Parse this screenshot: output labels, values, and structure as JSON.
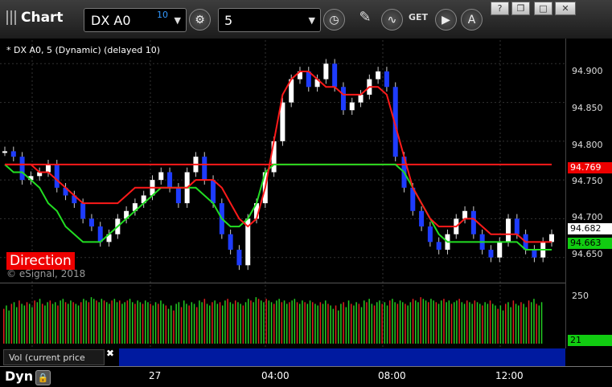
{
  "titlebar": {
    "app_title": "Chart",
    "symbol": "DX A0",
    "symbol_badge": "10",
    "interval": "5",
    "icons": [
      "settings-gear-icon",
      "clock-icon",
      "pencil-icon",
      "study-icon",
      "get-icon",
      "play-icon",
      "alert-icon"
    ],
    "window_buttons": [
      "help-button",
      "restore-button",
      "maximize-button",
      "close-button"
    ]
  },
  "chart": {
    "label": "* DX A0, 5 (Dynamic) (delayed 10)",
    "direction_label": "Direction",
    "copyright": "© eSignal, 2018",
    "y_ticks": [
      "94.900",
      "94.850",
      "94.800",
      "94.750",
      "94.700",
      "94.650"
    ],
    "red_tag": "94.769",
    "white_tag": "94.682",
    "green_tag": "94.663",
    "vol_label": "Vol (current price bar)",
    "vol_tick": "250",
    "vol_tag": "21",
    "x_ticks": [
      "27",
      "04:00",
      "08:00",
      "12:00"
    ],
    "dyn_label": "Dyn",
    "colors": {
      "red": "#ff1a1a",
      "green": "#22dd22",
      "blue": "#1e3cff",
      "white": "#ffffff"
    }
  },
  "chart_data": {
    "type": "line",
    "ylim": [
      94.63,
      94.92
    ],
    "series": [
      {
        "values": [
          94.787,
          94.78,
          94.75,
          94.755,
          94.76,
          94.77,
          94.74,
          94.73,
          94.72,
          94.7,
          94.69,
          94.67,
          94.68,
          94.7,
          94.71,
          94.72,
          94.73,
          94.75,
          94.76,
          94.74,
          94.72,
          94.76,
          94.78,
          94.75,
          94.72,
          94.68,
          94.66,
          94.64,
          94.7,
          94.72,
          94.76,
          94.8,
          94.85,
          94.88,
          94.89,
          94.87,
          94.88,
          94.9,
          94.87,
          94.84,
          94.85,
          94.86,
          94.88,
          94.89,
          94.87,
          94.78,
          94.74,
          94.71,
          94.69,
          94.67,
          94.66,
          94.68,
          94.7,
          94.71,
          94.68,
          94.66,
          94.65,
          94.67,
          94.7,
          94.68,
          94.66,
          94.65,
          94.67,
          94.68
        ]
      },
      {
        "values": [
          94.77,
          94.77,
          94.77,
          94.77,
          94.76,
          94.76,
          94.75,
          94.74,
          94.73,
          94.72,
          94.72,
          94.72,
          94.72,
          94.72,
          94.73,
          94.74,
          94.74,
          94.74,
          94.74,
          94.74,
          94.74,
          94.74,
          94.75,
          94.75,
          94.75,
          94.74,
          94.72,
          94.7,
          94.69,
          94.7,
          94.74,
          94.8,
          94.86,
          94.88,
          94.89,
          94.89,
          94.88,
          94.87,
          94.87,
          94.86,
          94.86,
          94.86,
          94.87,
          94.87,
          94.86,
          94.82,
          94.78,
          94.74,
          94.72,
          94.7,
          94.69,
          94.69,
          94.69,
          94.7,
          94.7,
          94.69,
          94.68,
          94.68,
          94.68,
          94.68,
          94.67,
          94.67,
          94.67,
          94.67
        ]
      },
      {
        "values": [
          94.77,
          94.77,
          94.77,
          94.77,
          94.77,
          94.77,
          94.77,
          94.77,
          94.77,
          94.77,
          94.77,
          94.77,
          94.77,
          94.77,
          94.77,
          94.77,
          94.77,
          94.77,
          94.77,
          94.77,
          94.77,
          94.77,
          94.77,
          94.77,
          94.77,
          94.77,
          94.77,
          94.77,
          94.77,
          94.77,
          94.77,
          94.77,
          94.77,
          94.77,
          94.77,
          94.77,
          94.77,
          94.77,
          94.77,
          94.77,
          94.77,
          94.77,
          94.77,
          94.77,
          94.77,
          94.77,
          94.77,
          94.77,
          94.77,
          94.77,
          94.77,
          94.77,
          94.77,
          94.77,
          94.77,
          94.77,
          94.77,
          94.77,
          94.77,
          94.77,
          94.77,
          94.77,
          94.77,
          94.77
        ]
      },
      {
        "values": [
          94.77,
          94.76,
          94.76,
          94.75,
          94.74,
          94.72,
          94.71,
          94.69,
          94.68,
          94.67,
          94.67,
          94.67,
          94.68,
          94.69,
          94.7,
          94.71,
          94.72,
          94.73,
          94.74,
          94.74,
          94.74,
          94.74,
          94.74,
          94.73,
          94.72,
          94.7,
          94.69,
          94.69,
          94.7,
          94.72,
          94.76,
          94.77,
          94.77,
          94.77,
          94.77,
          94.77,
          94.77,
          94.77,
          94.77,
          94.77,
          94.77,
          94.77,
          94.77,
          94.77,
          94.77,
          94.77,
          94.76,
          94.74,
          94.72,
          94.7,
          94.68,
          94.67,
          94.67,
          94.67,
          94.67,
          94.67,
          94.67,
          94.67,
          94.67,
          94.67,
          94.66,
          94.66,
          94.66,
          94.66
        ]
      }
    ],
    "volume": [
      210,
      230,
      200,
      240,
      250,
      220,
      260,
      240,
      230,
      250,
      240,
      220,
      260,
      250,
      270,
      240,
      230,
      250,
      260,
      240,
      250,
      230,
      260,
      270,
      250,
      240,
      260,
      250,
      240,
      230,
      250,
      270,
      260,
      250,
      280,
      270,
      260,
      250,
      270,
      260,
      250,
      240,
      260,
      270,
      250,
      260,
      240,
      250,
      260,
      270,
      250,
      240,
      260,
      250,
      240,
      260,
      250,
      240,
      230,
      250,
      240,
      260,
      240,
      230
    ]
  }
}
